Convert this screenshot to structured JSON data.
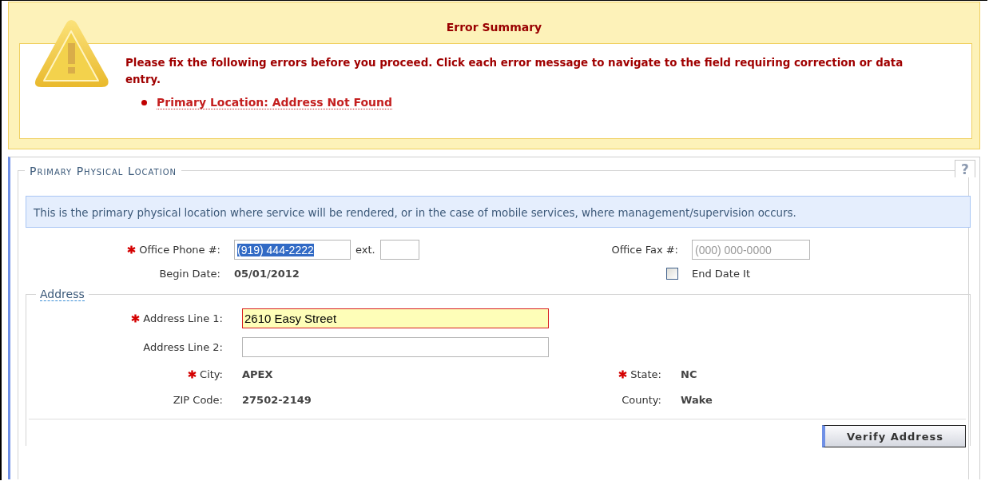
{
  "error_summary": {
    "title": "Error Summary",
    "message": "Please fix the following errors before you proceed. Click each error message to navigate to the field requiring correction or data entry.",
    "errors": [
      "Primary Location: Address Not Found"
    ]
  },
  "section": {
    "title": "Primary Physical Location",
    "help": "?",
    "info": "This is the primary physical location where service will be rendered, or in the case of mobile services, where management/supervision occurs."
  },
  "phone": {
    "label": "Office Phone #:",
    "required": true,
    "value": "(919) 444-2222",
    "text_selected": true,
    "ext_label": "ext."
  },
  "fax": {
    "label": "Office Fax #:",
    "required": false,
    "placeholder": "(000) 000-0000"
  },
  "begin_date": {
    "label": "Begin Date:",
    "value": "05/01/2012"
  },
  "end_date": {
    "label": "End Date It",
    "checked": false
  },
  "address": {
    "legend": "Address",
    "fields": [
      {
        "kind": "input",
        "label": "Address Line 1:",
        "required": true,
        "value": "2610 Easy Street",
        "error": true
      },
      {
        "kind": "input",
        "label": "Address Line 2:",
        "required": false,
        "error": false
      },
      {
        "kind": "text",
        "label": "City:",
        "required": true,
        "value": "APEX"
      },
      {
        "kind": "text",
        "label": "State:",
        "required": true,
        "value": "NC"
      },
      {
        "kind": "text",
        "label": "ZIP Code:",
        "required": false,
        "value": "27502-2149"
      },
      {
        "kind": "text",
        "label": "County:",
        "required": false,
        "value": "Wake"
      }
    ],
    "button": "Verify Address"
  }
}
